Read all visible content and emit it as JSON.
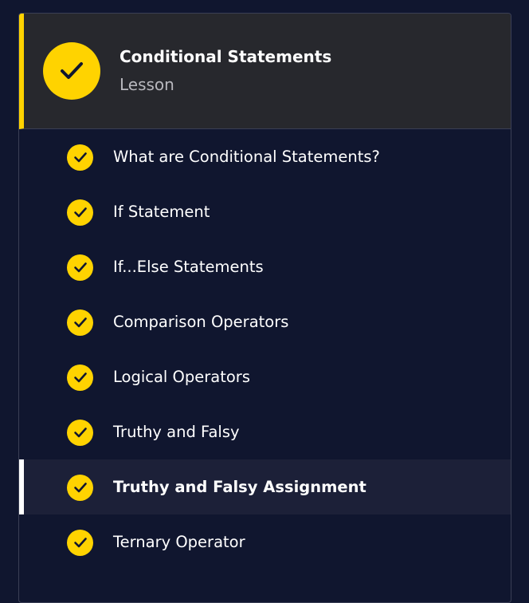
{
  "lesson": {
    "title": "Conditional Statements",
    "type": "Lesson",
    "status_icon": "check-icon"
  },
  "accent_color": "#ffd300",
  "items": [
    {
      "label": "What are Conditional Statements?",
      "completed": true,
      "active": false
    },
    {
      "label": "If Statement",
      "completed": true,
      "active": false
    },
    {
      "label": "If...Else Statements",
      "completed": true,
      "active": false
    },
    {
      "label": "Comparison Operators",
      "completed": true,
      "active": false
    },
    {
      "label": "Logical Operators",
      "completed": true,
      "active": false
    },
    {
      "label": "Truthy and Falsy",
      "completed": true,
      "active": false
    },
    {
      "label": "Truthy and Falsy Assignment",
      "completed": true,
      "active": true
    },
    {
      "label": "Ternary Operator",
      "completed": true,
      "active": false
    }
  ]
}
